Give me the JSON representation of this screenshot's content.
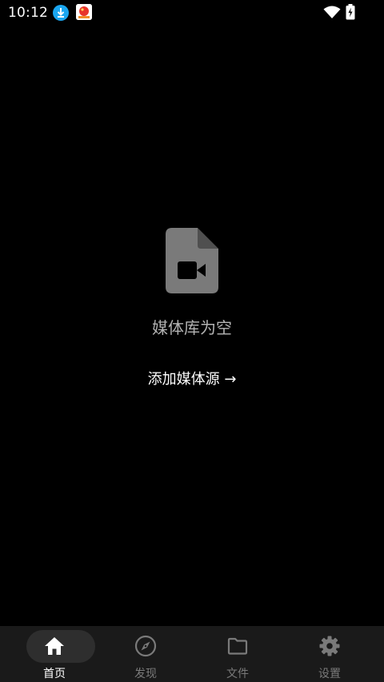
{
  "status_bar": {
    "time": "10:12",
    "download_icon": "download-icon",
    "app_icon": "app-notification-icon",
    "wifi_icon": "wifi-icon",
    "battery_icon": "battery-charging-icon"
  },
  "empty_state": {
    "icon": "video-file-icon",
    "title": "媒体库为空",
    "action_label": "添加媒体源 →"
  },
  "bottom_nav": {
    "items": [
      {
        "label": "首页",
        "icon": "home-icon",
        "active": true
      },
      {
        "label": "发现",
        "icon": "compass-icon",
        "active": false
      },
      {
        "label": "文件",
        "icon": "folder-icon",
        "active": false
      },
      {
        "label": "设置",
        "icon": "gear-icon",
        "active": false
      }
    ]
  },
  "colors": {
    "background": "#000000",
    "nav_background": "#1a1a1a",
    "active_pill": "#2e2e2e",
    "muted_text": "#b3b3b3",
    "inactive_nav": "#7a7a7a",
    "download_badge": "#1aa6f0"
  }
}
